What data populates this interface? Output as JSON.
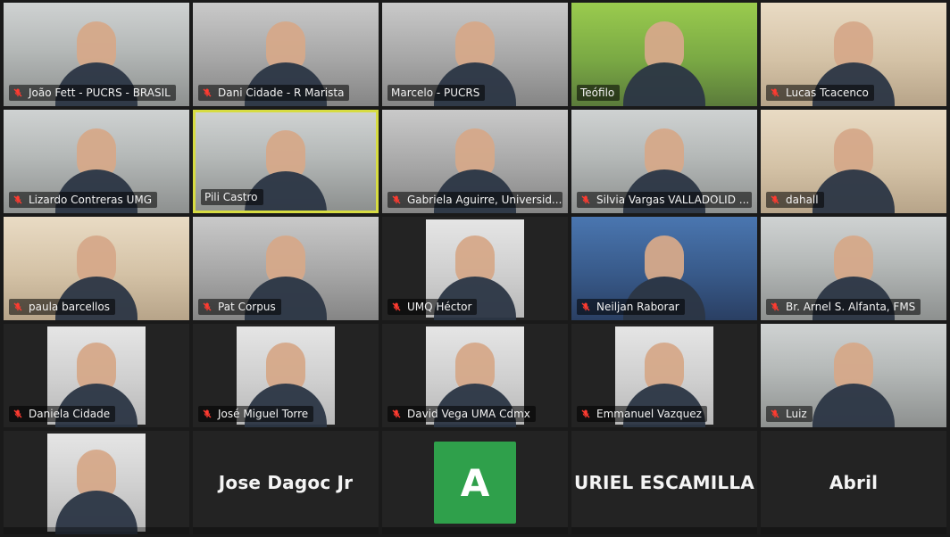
{
  "participants": [
    {
      "name": "João Fett - PUCRS - BRASIL",
      "muted": true
    },
    {
      "name": "Dani Cidade - R Marista",
      "muted": true
    },
    {
      "name": "Marcelo - PUCRS",
      "muted": false
    },
    {
      "name": "Teófilo",
      "muted": false
    },
    {
      "name": "Lucas Tcacenco",
      "muted": true
    },
    {
      "name": "Lizardo Contreras UMG",
      "muted": true
    },
    {
      "name": "Pili Castro",
      "muted": false,
      "active": true
    },
    {
      "name": "Gabriela Aguirre, Universid...",
      "muted": true
    },
    {
      "name": "Silvia Vargas VALLADOLID ...",
      "muted": true
    },
    {
      "name": "dahall",
      "muted": true
    },
    {
      "name": "paula barcellos",
      "muted": true
    },
    {
      "name": "Pat Corpus",
      "muted": true
    },
    {
      "name": "UMQ Héctor",
      "muted": true
    },
    {
      "name": "Neiljan Raborar",
      "muted": true
    },
    {
      "name": "Br. Arnel S. Alfanta, FMS",
      "muted": true
    },
    {
      "name": "Daniela Cidade",
      "muted": true
    },
    {
      "name": "José Miguel Torre",
      "muted": true
    },
    {
      "name": "David Vega UMA Cdmx",
      "muted": true
    },
    {
      "name": "Emmanuel Vazquez",
      "muted": true
    },
    {
      "name": "Luiz",
      "muted": true
    }
  ],
  "bottom_row": {
    "tile_22_center_text": "Jose Dagoc Jr",
    "tile_23_avatar_letter": "A",
    "tile_24_center_text": "URIEL ESCAMILLA",
    "tile_25_center_text": "Abril"
  },
  "colors": {
    "active_speaker_border": "#d7dc42",
    "muted_icon": "#ff3b30",
    "avatar_bg": "#2fa04b"
  },
  "icons": {
    "muted": "muted-microphone-icon"
  }
}
